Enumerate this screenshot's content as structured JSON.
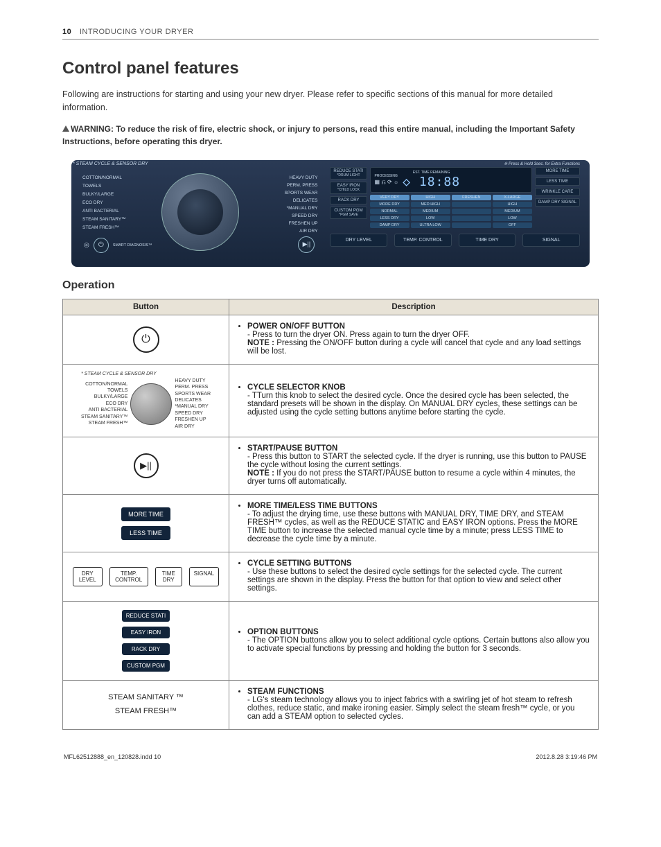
{
  "header": {
    "page_num": "10",
    "section": "INTRODUCING YOUR DRYER"
  },
  "title": "Control panel features",
  "intro": "Following are instructions for starting and using your new dryer. Please refer to specific sections of this manual for more detailed information.",
  "warning": "WARNING: To reduce the risk of fire, electric shock, or injury to persons, read this entire manual, including the Important Safety Instructions, before operating this dryer.",
  "panel": {
    "top_label": "* STEAM CYCLE & SENSOR DRY",
    "right_note": "※ Press & Hold 3sec. for Extra Functions",
    "left_cycles": [
      "COTTON/NORMAL",
      "TOWELS",
      "BULKY/LARGE",
      "ECO DRY",
      "ANTI BACTERIAL",
      "STEAM SANITARY™",
      "STEAM FRESH™"
    ],
    "right_cycles": [
      "HEAVY DUTY",
      "PERM. PRESS",
      "SPORTS WEAR",
      "DELICATES",
      "*MANUAL DRY",
      "SPEED DRY",
      "FRESHEN UP",
      "AIR DRY"
    ],
    "smart_label": "SMART DIAGNOSIS™",
    "options": [
      {
        "label": "REDUCE STATI",
        "sub": "*DRUM LIGHT"
      },
      {
        "label": "EASY IRON",
        "sub": "*CHILD LOCK"
      },
      {
        "label": "RACK DRY",
        "sub": ""
      },
      {
        "label": "CUSTOM PGM",
        "sub": "*PGM SAVE"
      }
    ],
    "processing": "PROCESSING",
    "est_time": "EST. TIME REMAINING",
    "segment": "18:88",
    "grid": [
      [
        "VERY DRY",
        "HIGH",
        "FRESHEN",
        "X-LARGE"
      ],
      [
        "MORE DRY",
        "MED HIGH",
        "",
        "HIGH"
      ],
      [
        "NORMAL",
        "MEDIUM",
        "",
        "MEDIUM"
      ],
      [
        "LESS DRY",
        "LOW",
        "",
        "LOW"
      ],
      [
        "DAMP DRY",
        "ULTRA LOW",
        "",
        "OFF"
      ]
    ],
    "time_buttons": [
      "MORE TIME",
      "LESS TIME",
      "WRINKLE CARE",
      "DAMP DRY SIGNAL"
    ],
    "bottom_buttons": [
      "DRY LEVEL",
      "TEMP. CONTROL",
      "TIME DRY",
      "SIGNAL"
    ]
  },
  "operation_heading": "Operation",
  "table": {
    "col1": "Button",
    "col2": "Description",
    "rows": [
      {
        "btn_type": "power",
        "title": "POWER ON/OFF BUTTON",
        "lines": [
          "- Press to turn the dryer ON. Press again to turn the dryer OFF.",
          "NOTE : Pressing the ON/OFF button during a cycle will cancel that cycle and any load settings will be lost."
        ]
      },
      {
        "btn_type": "knob",
        "title": "CYCLE SELECTOR KNOB",
        "lines": [
          "- TTurn this knob to select the desired cycle. Once the desired cycle has been selected, the standard presets will be shown in the display. On MANUAL DRY cycles, these settings can be adjusted using the cycle setting buttons anytime before starting the cycle."
        ]
      },
      {
        "btn_type": "play",
        "title": "START/PAUSE BUTTON",
        "lines": [
          "- Press this button to START the selected cycle. If the dryer is running, use this button to PAUSE the cycle without losing the current settings.",
          "NOTE : If you do not press the START/PAUSE button to resume a cycle within 4 minutes, the dryer turns off automatically."
        ]
      },
      {
        "btn_type": "moretime",
        "title": "MORE TIME/LESS TIME BUTTONS",
        "lines": [
          "- To adjust the drying time, use these buttons with MANUAL DRY, TIME DRY, and STEAM FRESH™ cycles, as well as the REDUCE STATIC and EASY IRON options. Press the MORE TIME button to increase the selected manual cycle time by a minute; press LESS TIME to decrease the cycle time by a minute."
        ]
      },
      {
        "btn_type": "settings",
        "title": "CYCLE SETTING BUTTONS",
        "lines": [
          "- Use these buttons to select the desired cycle settings for the selected cycle. The current settings are shown in the display. Press the button for that option to view and select other settings."
        ]
      },
      {
        "btn_type": "options",
        "title": "OPTION BUTTONS",
        "lines": [
          "- The OPTION buttons allow you to select additional cycle options. Certain buttons also allow you to activate special functions by pressing and holding the button for 3 seconds."
        ]
      },
      {
        "btn_type": "steam",
        "left_labels": [
          "STEAM SANITARY ™",
          "STEAM FRESH™"
        ],
        "title": "STEAM FUNCTIONS",
        "lines": [
          "- LG's steam technology allows you to inject fabrics with a swirling jet of hot steam to refresh clothes, reduce static, and make ironing easier. Simply select the steam fresh™ cycle, or you can add a STEAM option to selected cycles."
        ]
      }
    ]
  },
  "footer": {
    "left": "MFL62512888_en_120828.indd   10",
    "right": "2012.8.28   3:19:46 PM"
  },
  "graphics_labels": {
    "more_time": "MORE TIME",
    "less_time": "LESS TIME",
    "dry_level": "DRY LEVEL",
    "temp_control": "TEMP. CONTROL",
    "time_dry": "TIME DRY",
    "signal": "SIGNAL",
    "reduce_static": "REDUCE STATI",
    "easy_iron": "EASY IRON",
    "rack_dry": "RACK DRY",
    "custom_pgm": "CUSTOM PGM"
  }
}
